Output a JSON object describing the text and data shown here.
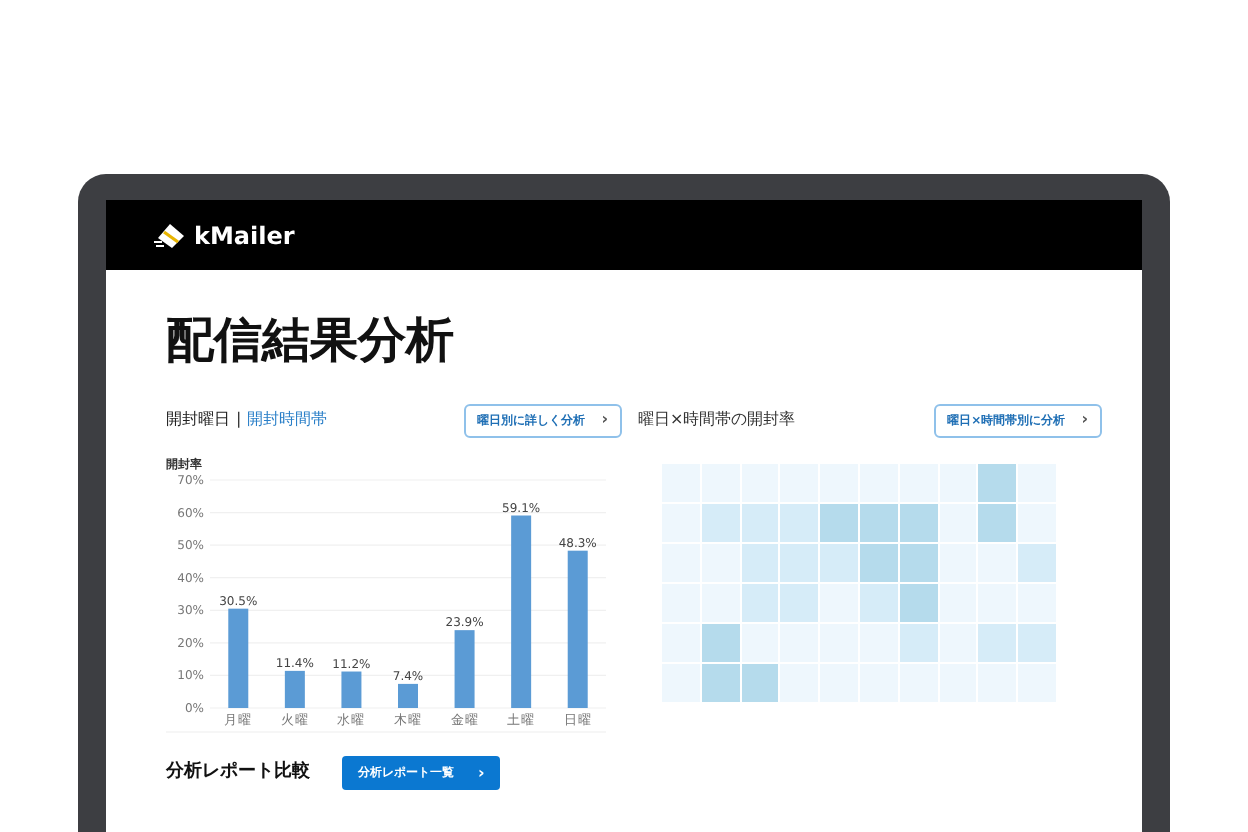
{
  "header": {
    "logo_text": "kMailer"
  },
  "page_title": "配信結果分析",
  "tabs": [
    {
      "label": "開封曜日",
      "selected": true
    },
    {
      "label": "開封時間帯",
      "selected": false
    }
  ],
  "tab_separator": "|",
  "weekday_button": {
    "label": "曜日別に詳しく分析",
    "arrow": "›"
  },
  "weekday_chart": {
    "chart_data": {
      "type": "bar",
      "ylabel": "開封率",
      "categories": [
        "月曜",
        "火曜",
        "水曜",
        "木曜",
        "金曜",
        "土曜",
        "日曜"
      ],
      "values": [
        30.5,
        11.4,
        11.2,
        7.4,
        23.9,
        59.1,
        48.3
      ],
      "ylim": [
        0,
        70
      ],
      "yticks": [
        {
          "value": 0,
          "label": "0%"
        },
        {
          "value": 10,
          "label": "10%"
        },
        {
          "value": 20,
          "label": "20%"
        },
        {
          "value": 30,
          "label": "30%"
        },
        {
          "value": 40,
          "label": "40%"
        },
        {
          "value": 50,
          "label": "50%"
        },
        {
          "value": 60,
          "label": "60%"
        },
        {
          "value": 70,
          "label": "70%"
        }
      ],
      "value_labels": [
        "30.5%",
        "11.4%",
        "11.2%",
        "7.4%",
        "23.9%",
        "59.1%",
        "48.3%"
      ],
      "color": "#5b9bd5",
      "grid": true
    }
  },
  "heatmap": {
    "title": "曜日×時間帯の開封率",
    "button": {
      "label": "曜日×時間帯別に分析",
      "arrow": "›"
    },
    "rows": [
      {
        "cells": [
          {
            "color": "#eef7fd"
          },
          {
            "color": "#eef7fd"
          },
          {
            "color": "#eef7fd"
          },
          {
            "color": "#eef7fd"
          },
          {
            "color": "#eef7fd"
          },
          {
            "color": "#eef7fd"
          },
          {
            "color": "#eef7fd"
          },
          {
            "color": "#eef7fd"
          },
          {
            "color": "#b5dbec"
          },
          {
            "color": "#eef7fd"
          }
        ]
      },
      {
        "cells": [
          {
            "color": "#eef7fd"
          },
          {
            "color": "#d6ecf8"
          },
          {
            "color": "#d6ecf8"
          },
          {
            "color": "#d6ecf8"
          },
          {
            "color": "#b5dbec"
          },
          {
            "color": "#b5dbec"
          },
          {
            "color": "#b5dbec"
          },
          {
            "color": "#eef7fd"
          },
          {
            "color": "#b5dbec"
          },
          {
            "color": "#eef7fd"
          }
        ]
      },
      {
        "cells": [
          {
            "color": "#eef7fd"
          },
          {
            "color": "#eef7fd"
          },
          {
            "color": "#d6ecf8"
          },
          {
            "color": "#d6ecf8"
          },
          {
            "color": "#d6ecf8"
          },
          {
            "color": "#b5dbec"
          },
          {
            "color": "#b5dbec"
          },
          {
            "color": "#eef7fd"
          },
          {
            "color": "#eef7fd"
          },
          {
            "color": "#d6ecf8"
          }
        ]
      },
      {
        "cells": [
          {
            "color": "#eef7fd"
          },
          {
            "color": "#eef7fd"
          },
          {
            "color": "#d6ecf8"
          },
          {
            "color": "#d6ecf8"
          },
          {
            "color": "#eef7fd"
          },
          {
            "color": "#d6ecf8"
          },
          {
            "color": "#b5dbec"
          },
          {
            "color": "#eef7fd"
          },
          {
            "color": "#eef7fd"
          },
          {
            "color": "#eef7fd"
          }
        ]
      },
      {
        "cells": [
          {
            "color": "#eef7fd"
          },
          {
            "color": "#b5dbec"
          },
          {
            "color": "#eef7fd"
          },
          {
            "color": "#eef7fd"
          },
          {
            "color": "#eef7fd"
          },
          {
            "color": "#eef7fd"
          },
          {
            "color": "#d6ecf8"
          },
          {
            "color": "#eef7fd"
          },
          {
            "color": "#d6ecf8"
          },
          {
            "color": "#d6ecf8"
          }
        ]
      },
      {
        "cells": [
          {
            "color": "#eef7fd"
          },
          {
            "color": "#b5dbec"
          },
          {
            "color": "#b5dbec"
          },
          {
            "color": "#eef7fd"
          },
          {
            "color": "#eef7fd"
          },
          {
            "color": "#eef7fd"
          },
          {
            "color": "#eef7fd"
          },
          {
            "color": "#eef7fd"
          },
          {
            "color": "#eef7fd"
          },
          {
            "color": "#eef7fd"
          }
        ]
      }
    ]
  },
  "report_compare": {
    "title": "分析レポート比較",
    "button": {
      "label": "分析レポート一覧",
      "arrow": "›"
    }
  }
}
